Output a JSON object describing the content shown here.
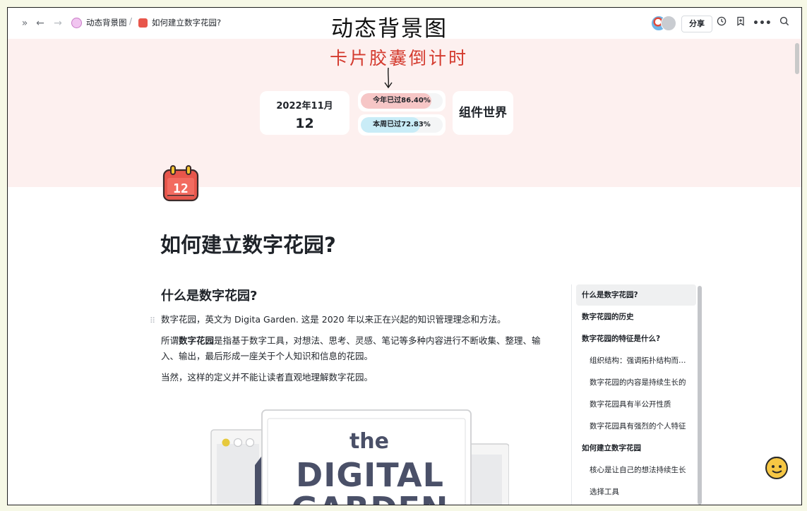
{
  "topbar": {
    "breadcrumb_parent": "动态背景图",
    "breadcrumb_current": "如何建立数字花园?",
    "overlay_title": "动态背景图",
    "share_label": "分享",
    "icons": [
      "expand-sidebar-icon",
      "back-arrow-icon",
      "forward-arrow-icon",
      "history-clock-icon",
      "bookmark-icon",
      "more-icon",
      "search-icon"
    ]
  },
  "cover": {
    "annotation": "卡片胶囊倒计时",
    "date_card": {
      "year_month": "2022年11月",
      "day": "12"
    },
    "progress": [
      {
        "label": "今年已过86.40%",
        "percent": 86.4,
        "color": "#f6c6c6"
      },
      {
        "label": "本周已过72.83%",
        "percent": 72.83,
        "color": "#c9ecf7"
      }
    ],
    "widget_card": "组件世界"
  },
  "page": {
    "icon_day": "12",
    "title": "如何建立数字花园?",
    "section_heading": "什么是数字花园?",
    "para1": "数字花园，英文为 Digita Garden. 这是 2020 年以来正在兴起的知识管理理念和方法。",
    "para2_prefix": "所谓",
    "para2_bold": "数字花园",
    "para2_suffix": "是指基于数字工具，对想法、思考、灵感、笔记等多种内容进行不断收集、整理、输入、输出，最后形成一座关于个人知识和信息的花园。",
    "para3": "当然，这样的定义并不能让读者直观地理解数字花园。",
    "illustration": {
      "line1": "the",
      "line2": "DIGITAL",
      "line3": "GARDEN"
    }
  },
  "toc": [
    {
      "label": "什么是数字花园?",
      "level": 1,
      "active": true
    },
    {
      "label": "数字花园的历史",
      "level": 1,
      "active": false
    },
    {
      "label": "数字花园的特征是什么?",
      "level": 1,
      "active": false
    },
    {
      "label": "组织结构：强调拓扑结构而…",
      "level": 2,
      "active": false
    },
    {
      "label": "数字花园的内容是持续生长的",
      "level": 2,
      "active": false
    },
    {
      "label": "数字花园具有半公开性质",
      "level": 2,
      "active": false
    },
    {
      "label": "数字花园具有强烈的个人特征",
      "level": 2,
      "active": false
    },
    {
      "label": "如何建立数字花园",
      "level": 1,
      "active": false
    },
    {
      "label": "核心是让自己的想法持续生长",
      "level": 2,
      "active": false
    },
    {
      "label": "选择工具",
      "level": 2,
      "active": false
    }
  ]
}
